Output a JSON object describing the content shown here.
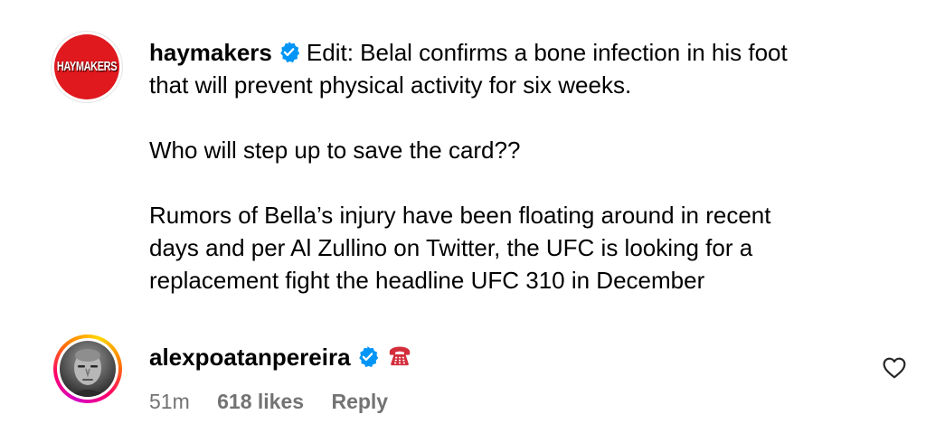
{
  "post": {
    "username": "haymakers",
    "avatar_logo_text": "HAYMAKERS",
    "paragraphs": [
      "Edit: Belal confirms a bone infection in his foot that will prevent physical activity for six weeks.",
      "Who will step up to save the card??",
      "Rumors of Bella’s injury have been floating around in recent days and per Al Zullino on Twitter, the UFC is looking for a replacement fight the headline UFC 310 in December"
    ],
    "caption_lines": [
      "that will prevent physical activity for six weeks.",
      "Rumors of Bella’s injury have been floating around in recent",
      "days and per Al Zullino on Twitter, the UFC is looking for a",
      "replacement fight the headline UFC 310 in December"
    ],
    "first_line_text": "Edit: Belal confirms a bone infection in his foot"
  },
  "comment": {
    "username": "alexpoatanpereira",
    "emoji_icon": "telephone-icon",
    "time": "51m",
    "likes": "618 likes",
    "reply_label": "Reply"
  },
  "colors": {
    "verified_blue": "#0095f6",
    "meta_gray": "#737373",
    "brand_red": "#e0191f"
  }
}
